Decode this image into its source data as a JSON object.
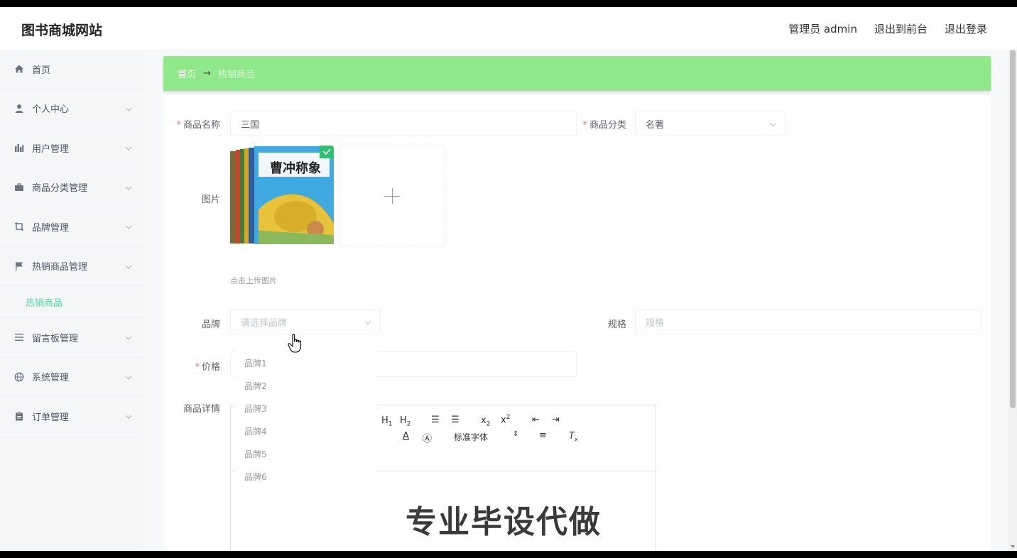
{
  "header": {
    "brand": "图书商城网站",
    "user": "管理员 admin",
    "to_front": "退出到前台",
    "logout": "退出登录"
  },
  "sidebar": {
    "items": [
      {
        "label": "首页",
        "icon": "home-icon"
      },
      {
        "label": "个人中心",
        "icon": "user-icon"
      },
      {
        "label": "用户管理",
        "icon": "chart-icon"
      },
      {
        "label": "商品分类管理",
        "icon": "briefcase-icon"
      },
      {
        "label": "品牌管理",
        "icon": "crop-icon"
      },
      {
        "label": "热销商品管理",
        "icon": "flag-icon"
      },
      {
        "label": "留言板管理",
        "icon": "list-icon"
      },
      {
        "label": "系统管理",
        "icon": "globe-icon"
      },
      {
        "label": "订单管理",
        "icon": "clipboard-icon"
      }
    ],
    "active_sub": "热销商品"
  },
  "breadcrumb": {
    "home": "首页",
    "current": "热销商品"
  },
  "form": {
    "name_label": "商品名称",
    "name_value": "三国",
    "category_label": "商品分类",
    "category_value": "名著",
    "image_label": "图片",
    "upload_hint": "点击上传图片",
    "book_title": "曹冲称象",
    "brand_label": "品牌",
    "brand_placeholder": "请选择品牌",
    "spec_label": "规格",
    "spec_placeholder": "规格",
    "price_label": "价格",
    "detail_label": "商品详情"
  },
  "brand_options": [
    "品牌1",
    "品牌2",
    "品牌3",
    "品牌4",
    "品牌5",
    "品牌6"
  ],
  "editor": {
    "font_select": "标准字体",
    "watermark": "专业毕设代做"
  },
  "colors": {
    "breadcrumb_bg": "#8fe98a",
    "accent": "#5fd3a4",
    "required": "#f56c6c"
  }
}
